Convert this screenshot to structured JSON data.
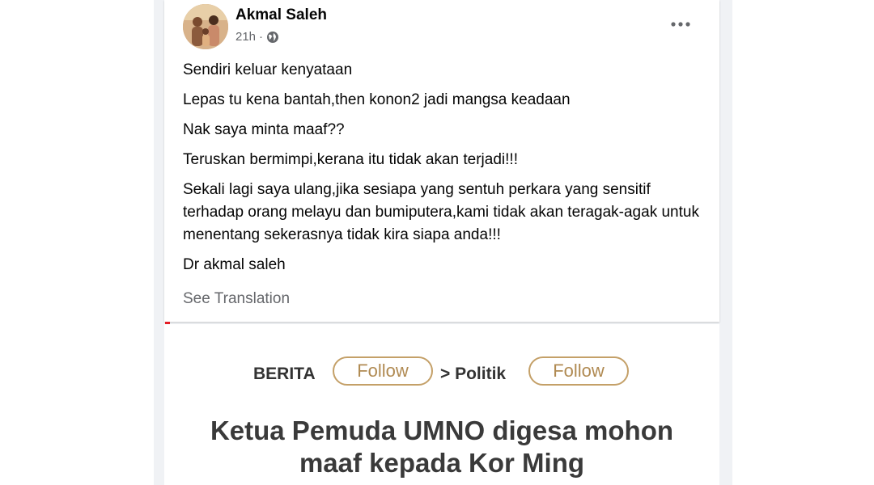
{
  "post": {
    "author": "Akmal Saleh",
    "time": "21h",
    "separator": "·",
    "privacy_icon": "globe-icon",
    "more_icon": "ellipsis-icon",
    "paragraphs": [
      "Sendiri keluar kenyataan",
      "Lepas tu kena bantah,then konon2 jadi mangsa keadaan",
      "Nak saya minta maaf??",
      "Teruskan bermimpi,kerana itu tidak akan terjadi!!!",
      "Sekali lagi saya ulang,jika sesiapa yang sentuh perkara yang sensitif terhadap orang melayu dan bumiputera,kami tidak akan teragak-agak untuk menentang sekerasnya tidak kira siapa anda!!!",
      "Dr akmal saleh"
    ],
    "see_translation": "See Translation"
  },
  "attachment": {
    "crumb1": "BERITA",
    "follow1": "Follow",
    "crumb2": "> Politik",
    "follow2": "Follow",
    "headline_line1": "Ketua Pemuda UMNO digesa mohon",
    "headline_line2": "maaf kepada Kor Ming"
  },
  "colors": {
    "follow_border": "#c4a068",
    "accent_red": "#e41e26"
  }
}
